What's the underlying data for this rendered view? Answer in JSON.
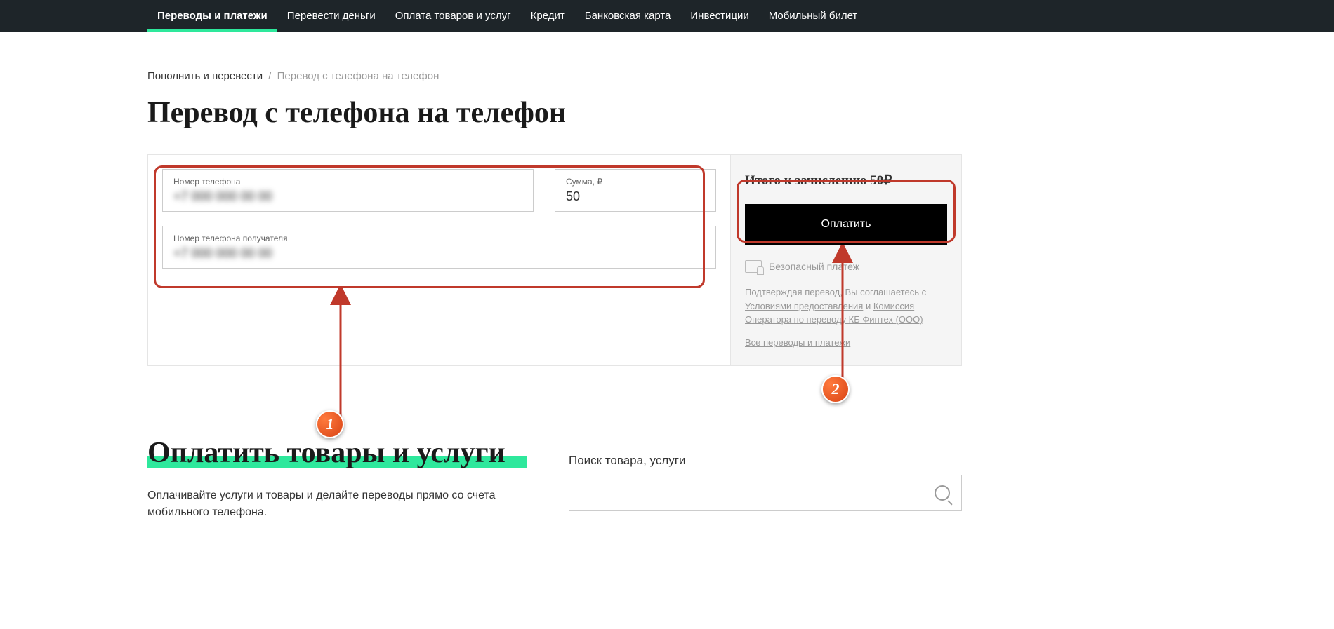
{
  "navbar": {
    "items": [
      {
        "label": "Переводы и платежи",
        "active": true
      },
      {
        "label": "Перевести деньги",
        "active": false
      },
      {
        "label": "Оплата товаров и услуг",
        "active": false
      },
      {
        "label": "Кредит",
        "active": false
      },
      {
        "label": "Банковская карта",
        "active": false
      },
      {
        "label": "Инвестиции",
        "active": false
      },
      {
        "label": "Мобильный билет",
        "active": false
      }
    ]
  },
  "breadcrumb": {
    "parent": "Пополнить и перевести",
    "current": "Перевод с телефона на телефон"
  },
  "page": {
    "title": "Перевод с телефона на телефон"
  },
  "form": {
    "phone_label": "Номер телефона",
    "phone_value": "+7 000 000 00 00",
    "amount_label": "Сумма, ₽",
    "amount_value": "50",
    "recipient_label": "Номер телефона получателя",
    "recipient_value": "+7 000 000 00 00"
  },
  "summary": {
    "total_label": "Итого к зачислению 50₽",
    "pay_button": "Оплатить",
    "secure_text": "Безопасный платеж",
    "disclaimer_prefix": "Подтверждая перевод, Вы соглашаетесь с ",
    "disclaimer_link1": "Условиями предоставления",
    "disclaimer_mid": " и ",
    "disclaimer_link2": "Комиссия Оператора по переводу КБ Финтех (ООО)",
    "all_transfers": "Все переводы и платежи"
  },
  "annotations": {
    "n1": "1",
    "n2": "2"
  },
  "services": {
    "title": "Оплатить товары и услуги",
    "description": "Оплачивайте услуги и товары и делайте переводы прямо со счета мобильного телефона.",
    "search_label": "Поиск товара, услуги",
    "search_placeholder": ""
  }
}
